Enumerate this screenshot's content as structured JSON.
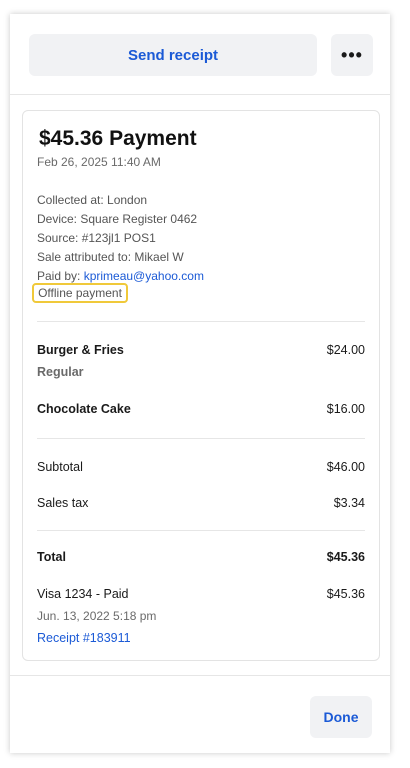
{
  "header": {
    "send_receipt_label": "Send receipt",
    "more_label": "•••"
  },
  "payment": {
    "title": "$45.36 Payment",
    "date": "Feb 26, 2025 11:40 AM",
    "collected_at": "Collected at: London",
    "device": "Device: Square Register 0462",
    "source": "Source: #123jl1 POS1",
    "sale_attributed": "Sale attributed to: Mikael W",
    "paid_by_label": "Paid by: ",
    "paid_by_email": "kprimeau@yahoo.com",
    "offline_label": "Offline payment"
  },
  "items": [
    {
      "name": "Burger & Fries",
      "price": "$24.00",
      "variant": "Regular"
    },
    {
      "name": "Chocolate Cake",
      "price": "$16.00"
    }
  ],
  "totals": {
    "subtotal_label": "Subtotal",
    "subtotal_value": "$46.00",
    "tax_label": "Sales tax",
    "tax_value": "$3.34",
    "total_label": "Total",
    "total_value": "$45.36"
  },
  "tender": {
    "card_label": "Visa 1234 - Paid",
    "amount": "$45.36",
    "date": "Jun. 13, 2022 5:18 pm",
    "receipt_link": "Receipt #183911"
  },
  "footer": {
    "done_label": "Done"
  },
  "colors": {
    "accent": "#1b5ad6",
    "highlight": "#f0c93a"
  }
}
